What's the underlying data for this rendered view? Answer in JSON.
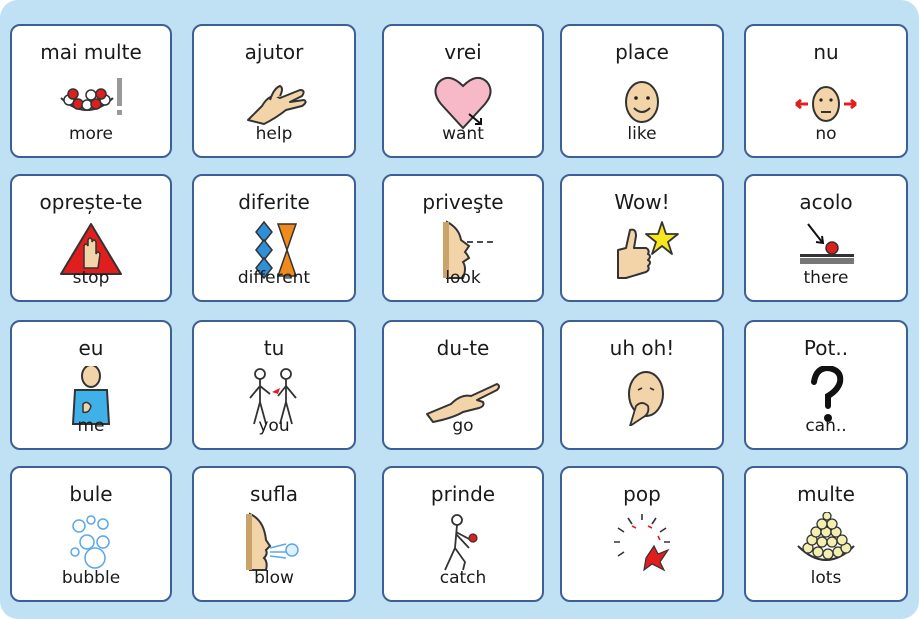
{
  "colors": {
    "background": "#bfe1f3",
    "cell_border": "#3d5f95",
    "cell_fill": "#ffffff",
    "skin": "#f3d3a8",
    "accent_red": "#e01e1e",
    "accent_blue": "#2f8fd8",
    "accent_orange": "#f08a1c",
    "accent_yellow": "#f5e61e"
  },
  "cells": [
    {
      "label": "mai multe",
      "gloss": "more",
      "icon": "more-icon"
    },
    {
      "label": "ajutor",
      "gloss": "help",
      "icon": "help-hand-icon"
    },
    {
      "label": "vrei",
      "gloss": "want",
      "icon": "heart-icon"
    },
    {
      "label": "place",
      "gloss": "like",
      "icon": "smiling-face-icon"
    },
    {
      "label": "nu",
      "gloss": "no",
      "icon": "shaking-head-icon"
    },
    {
      "label": "oprește-te",
      "gloss": "stop",
      "icon": "stop-sign-icon"
    },
    {
      "label": "diferite",
      "gloss": "different",
      "icon": "different-shapes-icon"
    },
    {
      "label": "priveşte",
      "gloss": "look",
      "icon": "look-face-icon"
    },
    {
      "label": "Wow!",
      "gloss": "",
      "icon": "thumbs-up-star-icon"
    },
    {
      "label": "acolo",
      "gloss": "there",
      "icon": "there-pointer-icon"
    },
    {
      "label": "eu",
      "gloss": "me",
      "icon": "person-me-icon"
    },
    {
      "label": "tu",
      "gloss": "you",
      "icon": "two-people-you-icon"
    },
    {
      "label": "du-te",
      "gloss": "go",
      "icon": "pointing-hand-icon"
    },
    {
      "label": "uh  oh!",
      "gloss": "",
      "icon": "uh-oh-face-icon"
    },
    {
      "label": "Pot..",
      "gloss": "can..",
      "icon": "question-mark-icon"
    },
    {
      "label": "bule",
      "gloss": "bubble",
      "icon": "bubbles-icon"
    },
    {
      "label": "sufla",
      "gloss": "blow",
      "icon": "blow-face-icon"
    },
    {
      "label": "prinde",
      "gloss": "catch",
      "icon": "catch-ball-icon"
    },
    {
      "label": "pop",
      "gloss": "",
      "icon": "pop-burst-icon"
    },
    {
      "label": "multe",
      "gloss": "lots",
      "icon": "lots-balls-icon"
    }
  ]
}
